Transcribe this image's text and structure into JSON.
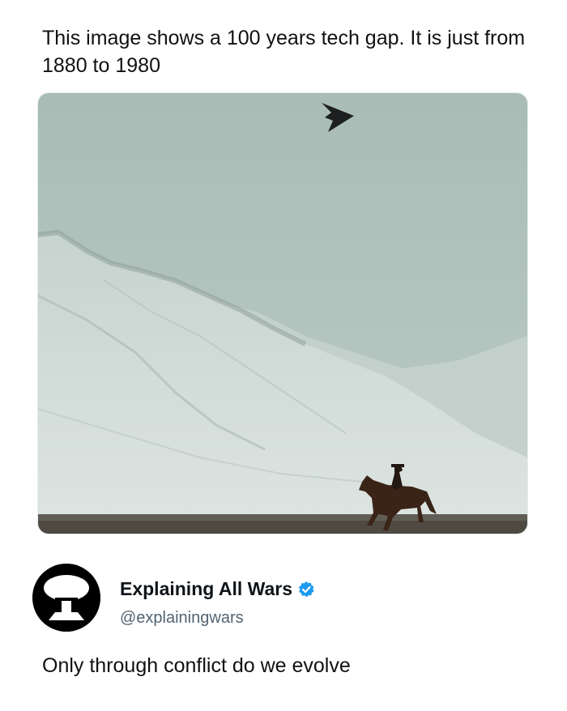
{
  "post": {
    "text": "This image shows a 100 years tech gap. It is just from 1880 to 1980"
  },
  "media": {
    "icons": [
      "stealth-bomber-icon",
      "horse-rider-silhouette"
    ]
  },
  "author": {
    "display_name": "Explaining All Wars",
    "handle": "@explainingwars",
    "verified": true,
    "verified_color": "#1d9bf0",
    "avatar_icon": "mushroom-cloud-icon"
  },
  "reply": {
    "text": "Only through conflict do we evolve"
  }
}
